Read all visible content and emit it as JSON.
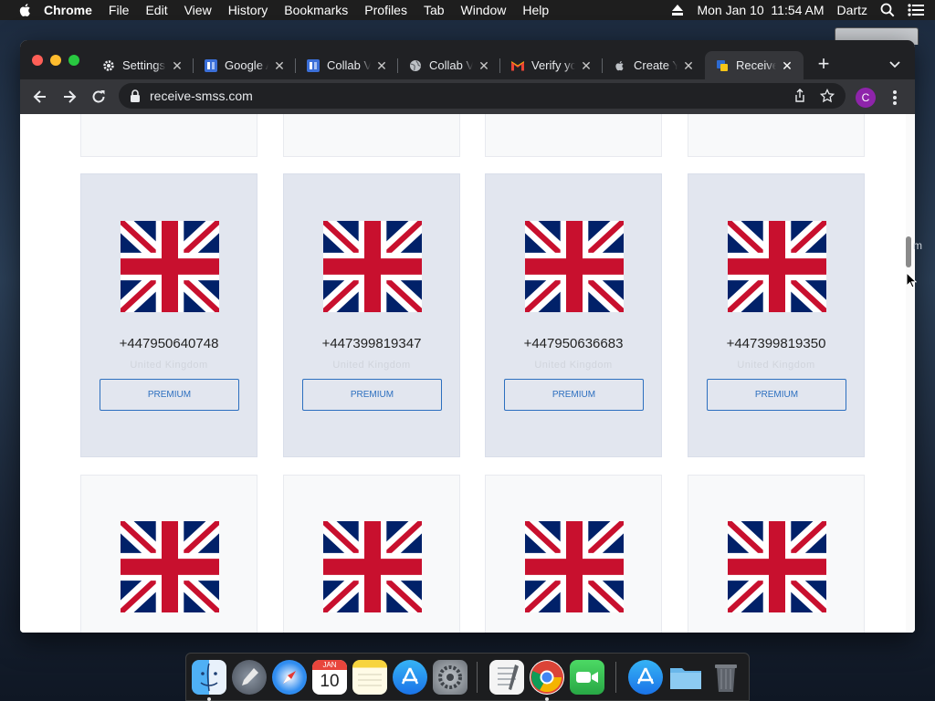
{
  "menubar": {
    "app_name": "Chrome",
    "menus": [
      "File",
      "Edit",
      "View",
      "History",
      "Bookmarks",
      "Profiles",
      "Tab",
      "Window",
      "Help"
    ],
    "clock": "Mon Jan 10  11:54 AM",
    "user": "Dartz"
  },
  "tabs": [
    {
      "title": "Settings",
      "icon": "gear-icon",
      "active": false
    },
    {
      "title": "Google Ads",
      "icon": "google-ads-icon",
      "active": false
    },
    {
      "title": "Collab Voice",
      "icon": "google-ads-icon",
      "active": false
    },
    {
      "title": "Collab Voice",
      "icon": "globe-icon",
      "active": false
    },
    {
      "title": "Verify your",
      "icon": "gmail-icon",
      "active": false
    },
    {
      "title": "Create Your",
      "icon": "apple-icon",
      "active": false
    },
    {
      "title": "Receive",
      "icon": "receive-smss-icon",
      "active": true
    }
  ],
  "address_bar": {
    "url": "receive-smss.com"
  },
  "profile_initial": "C",
  "cards": [
    {
      "number": "+447950640748",
      "country": "United Kingdom",
      "button": "PREMIUM"
    },
    {
      "number": "+447399819347",
      "country": "United Kingdom",
      "button": "PREMIUM"
    },
    {
      "number": "+447950636683",
      "country": "United Kingdom",
      "button": "PREMIUM"
    },
    {
      "number": "+447399819350",
      "country": "United Kingdom",
      "button": "PREMIUM"
    }
  ],
  "stray_text": "m",
  "dock": [
    "finder",
    "launchpad",
    "safari",
    "calendar",
    "notes",
    "app-store",
    "system-preferences",
    "textedit",
    "chrome",
    "facetime",
    "app-store-2",
    "downloads",
    "trash"
  ],
  "calendar": {
    "month": "JAN",
    "day": "10"
  },
  "colors": {
    "premium_card": "#e2e6ef",
    "button_blue": "#2c6fbf",
    "flag_blue": "#012169",
    "flag_red": "#c8102e"
  }
}
